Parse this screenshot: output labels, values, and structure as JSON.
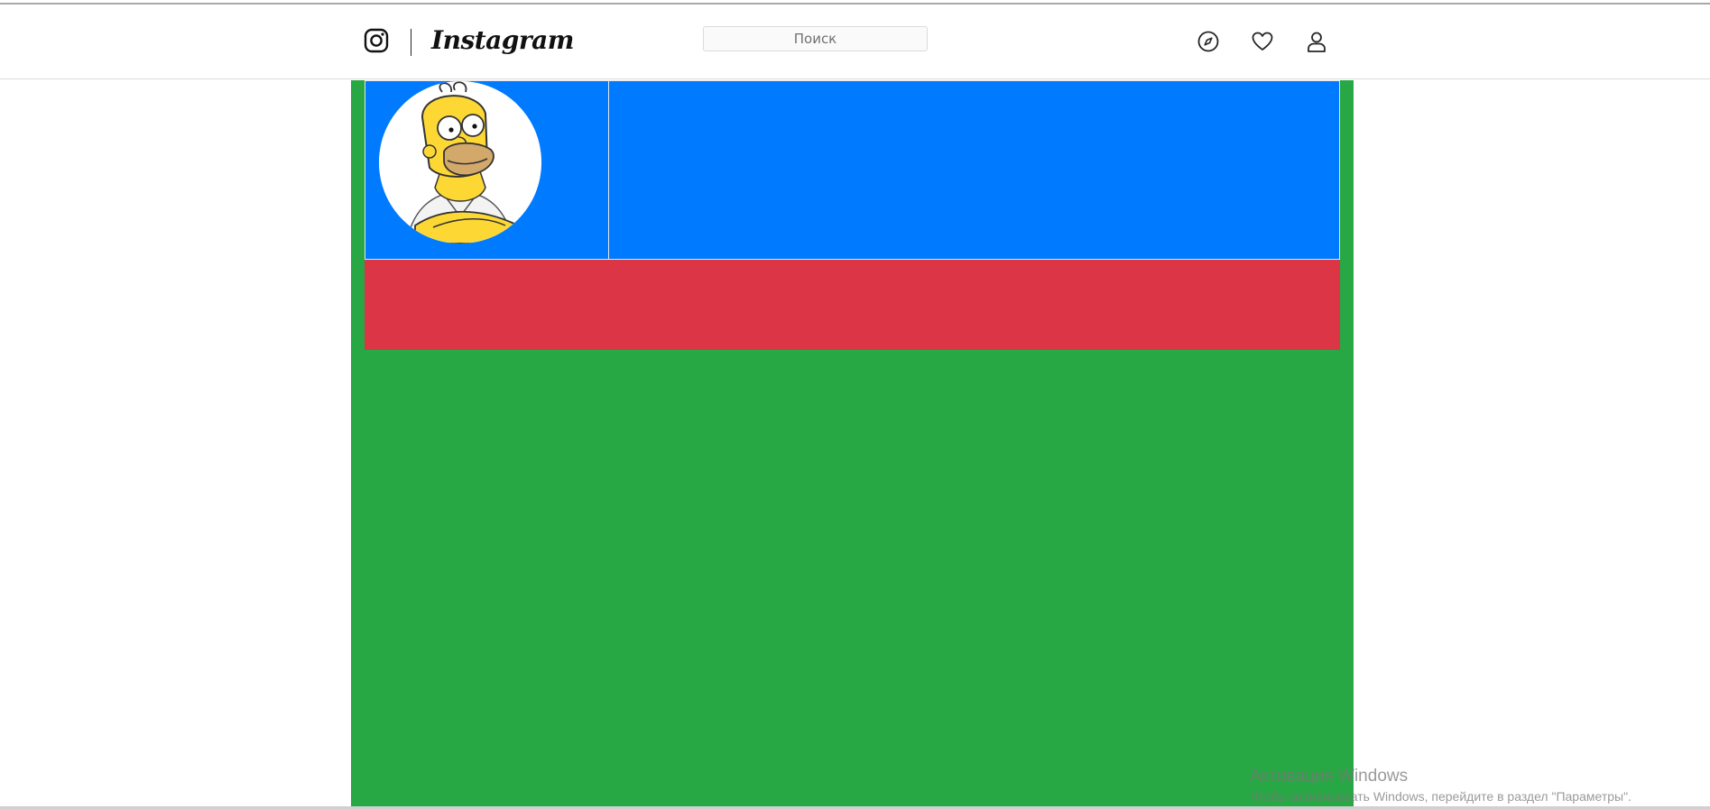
{
  "header": {
    "brand": "Instagram",
    "search_placeholder": "Поиск",
    "icons": [
      "instagram-glyph-icon",
      "compass-icon",
      "heart-icon",
      "user-icon"
    ]
  },
  "profile": {
    "avatar": "homer-simpson-avatar"
  },
  "colors": {
    "content_column": "#28a745",
    "header_row": "#007bff",
    "second_row": "#dc3545",
    "page_background": "#ffffff"
  },
  "watermark": {
    "title": "Активация Windows",
    "subtitle": "Чтобы активировать Windows, перейдите в раздел \"Параметры\"."
  }
}
